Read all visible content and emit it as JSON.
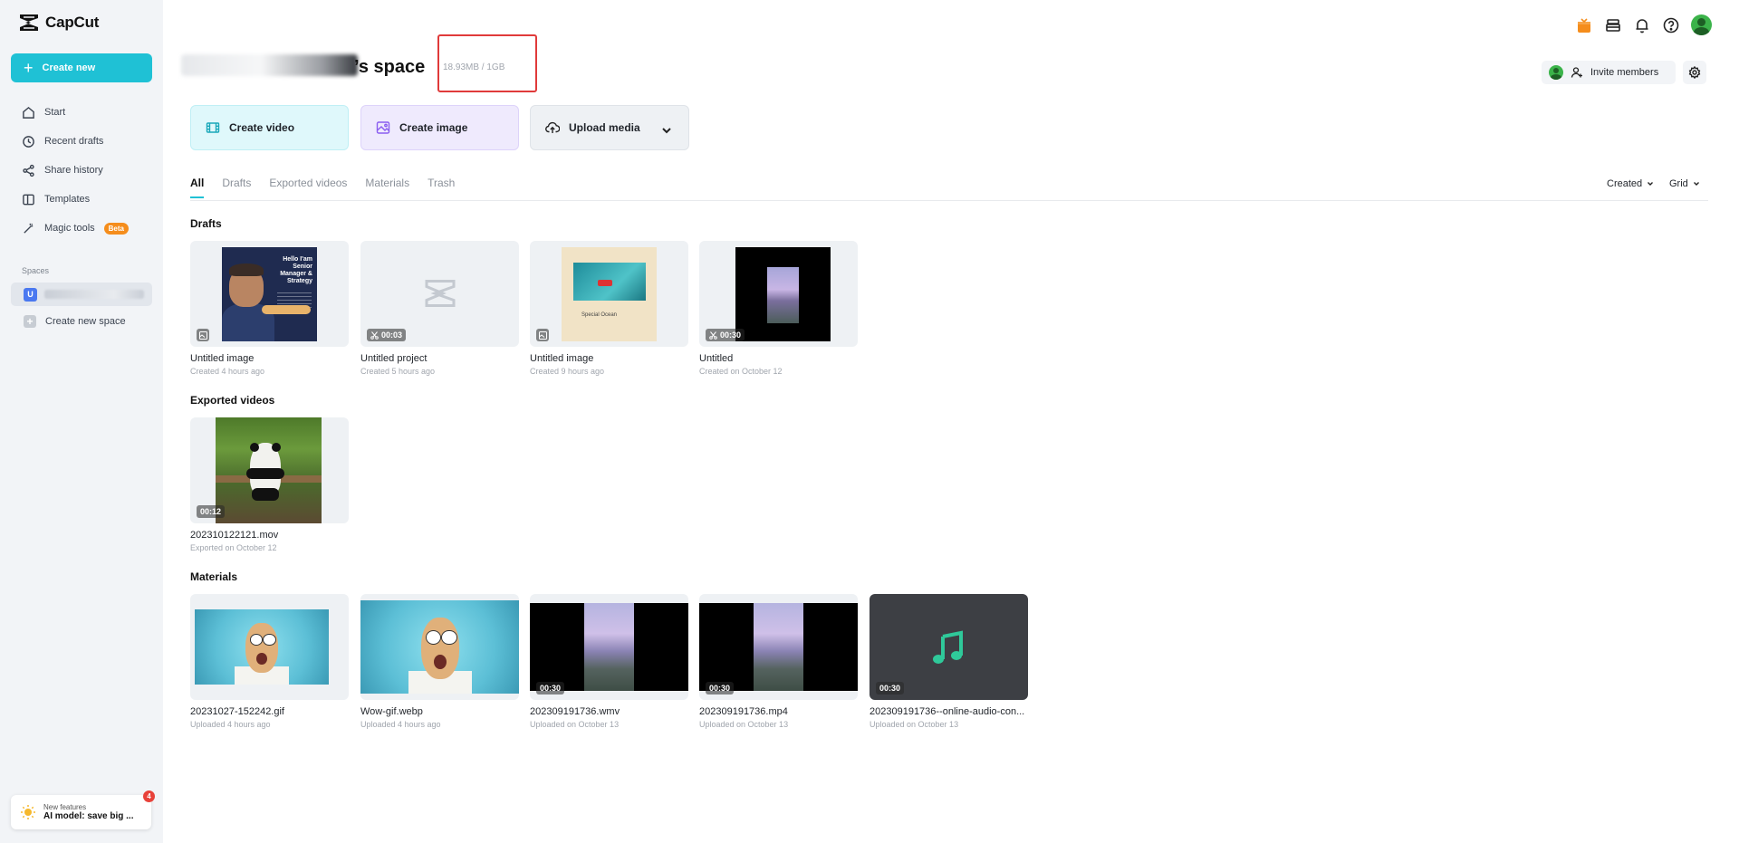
{
  "app": {
    "name": "CapCut",
    "colors": {
      "accent": "#1fc1d5",
      "beta": "#f58d1c",
      "highlight": "#e03a3a"
    }
  },
  "sidebar": {
    "create_new_label": "Create new",
    "items": [
      {
        "label": "Start",
        "icon": "home-icon"
      },
      {
        "label": "Recent drafts",
        "icon": "clock-icon"
      },
      {
        "label": "Share history",
        "icon": "share-icon"
      },
      {
        "label": "Templates",
        "icon": "template-icon"
      },
      {
        "label": "Magic tools",
        "icon": "magic-wand-icon",
        "badge": "Beta"
      }
    ],
    "spaces_label": "Spaces",
    "space_badge": "U",
    "create_space_label": "Create new space",
    "new_features": {
      "title": "New features",
      "subtitle": "AI model: save big ...",
      "count": "4"
    }
  },
  "header": {
    "space_title": "’s space",
    "storage": "18.93MB / 1GB",
    "invite_label": "Invite members"
  },
  "actions": {
    "create_video": "Create video",
    "create_image": "Create image",
    "upload_media": "Upload media"
  },
  "tabs": [
    "All",
    "Drafts",
    "Exported videos",
    "Materials",
    "Trash"
  ],
  "sort": {
    "order": "Created",
    "view": "Grid"
  },
  "sections": {
    "drafts": {
      "title": "Drafts",
      "items": [
        {
          "name": "Untitled image",
          "meta": "Created 4 hours ago",
          "duration": ""
        },
        {
          "name": "Untitled project",
          "meta": "Created 5 hours ago",
          "duration": "00:03"
        },
        {
          "name": "Untitled image",
          "meta": "Created 9 hours ago",
          "duration": ""
        },
        {
          "name": "Untitled",
          "meta": "Created on October 12",
          "duration": "00:30"
        }
      ],
      "poster_text": "Hello I'am Senior Manager & Strategy",
      "beige_caption": "Special Ocean"
    },
    "exported": {
      "title": "Exported videos",
      "items": [
        {
          "name": "202310122121.mov",
          "meta": "Exported on October 12",
          "duration": "00:12"
        }
      ]
    },
    "materials": {
      "title": "Materials",
      "items": [
        {
          "name": "20231027-152242.gif",
          "meta": "Uploaded 4 hours ago",
          "duration": ""
        },
        {
          "name": "Wow-gif.webp",
          "meta": "Uploaded 4 hours ago",
          "duration": ""
        },
        {
          "name": "202309191736.wmv",
          "meta": "Uploaded on October 13",
          "duration": "00:30"
        },
        {
          "name": "202309191736.mp4",
          "meta": "Uploaded on October 13",
          "duration": "00:30"
        },
        {
          "name": "202309191736--online-audio-con...",
          "meta": "Uploaded on October 13",
          "duration": "00:30"
        }
      ]
    }
  }
}
